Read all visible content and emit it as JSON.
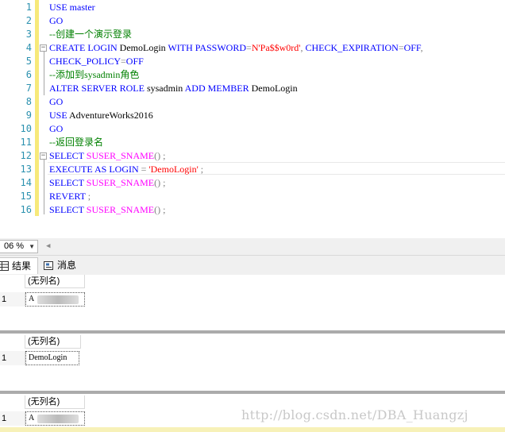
{
  "editor": {
    "line_numbers": [
      "1",
      "2",
      "3",
      "4",
      "5",
      "6",
      "7",
      "8",
      "9",
      "10",
      "11",
      "12",
      "13",
      "14",
      "15",
      "16"
    ],
    "lines": {
      "l1_use": "USE",
      "l1_db": " master",
      "l2": "GO",
      "l3": "--创建一个演示登录",
      "l4_a": "CREATE LOGIN",
      "l4_b": " DemoLogin ",
      "l4_c": "WITH PASSWORD",
      "l4_d": "=",
      "l4_e": "N'Pa$$w0rd'",
      "l4_f": ",",
      "l4_g": " CHECK_EXPIRATION",
      "l4_h": "=",
      "l4_i": "OFF",
      "l4_j": ",",
      "l5_a": "CHECK_POLICY",
      "l5_b": "=",
      "l5_c": "OFF",
      "l6": "--添加到sysadmin角色",
      "l7_a": "ALTER SERVER ROLE",
      "l7_b": " sysadmin ",
      "l7_c": "ADD MEMBER",
      "l7_d": " DemoLogin",
      "l8": "GO",
      "l9_a": "USE",
      "l9_b": " AdventureWorks2016",
      "l10": "GO",
      "l11": "--返回登录名",
      "l12_a": "SELECT",
      "l12_b": " SUSER_SNAME",
      "l12_c": "() ;",
      "l13_a": "EXECUTE AS LOGIN",
      "l13_b": " = ",
      "l13_c": "'DemoLogin'",
      "l13_d": " ;",
      "l14_a": "SELECT",
      "l14_b": " SUSER_SNAME",
      "l14_c": "() ;",
      "l15_a": "REVERT",
      "l15_b": " ;",
      "l16_a": "SELECT",
      "l16_b": " SUSER_SNAME",
      "l16_c": "() ;"
    }
  },
  "zoom": {
    "value": "06 %"
  },
  "tabs": {
    "results": "结果",
    "messages": "消息"
  },
  "results": {
    "column_header": "(无列名)",
    "row_number": "1",
    "grid1_value": "A",
    "grid2_value": "DemoLogin",
    "grid3_value": "A"
  },
  "watermark": "http://blog.csdn.net/DBA_Huangzj",
  "colors": {
    "keyword": "#0000ff",
    "function": "#ff00ff",
    "string": "#ff0000",
    "comment": "#008000",
    "line_number": "#2b91af"
  }
}
